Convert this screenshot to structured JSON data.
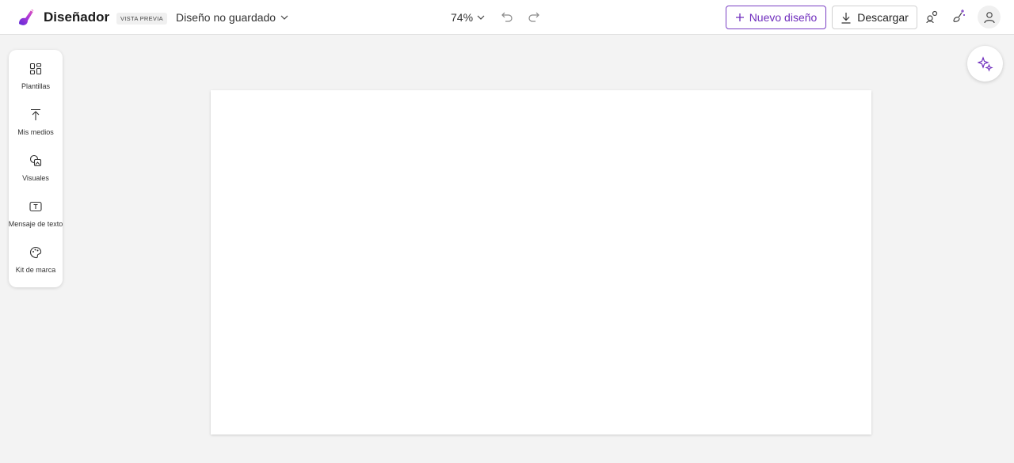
{
  "header": {
    "app_name": "Diseñador",
    "badge": "VISTA PREVIA",
    "doc_title": "Diseño no guardado",
    "zoom": "74%",
    "new_design_label": "Nuevo diseño",
    "download_label": "Descargar",
    "icons": [
      "logo-icon",
      "chevron-down-icon",
      "undo-icon",
      "redo-icon",
      "plus-icon",
      "download-icon",
      "share-icon",
      "sparkle-brush-icon",
      "user-icon"
    ]
  },
  "sidebar": {
    "items": [
      {
        "label": "Plantillas",
        "icon": "templates-icon"
      },
      {
        "label": "Mis medios",
        "icon": "upload-icon"
      },
      {
        "label": "Visuales",
        "icon": "visuals-icon"
      },
      {
        "label": "Mensaje de texto",
        "icon": "text-icon"
      },
      {
        "label": "Kit de marca",
        "icon": "palette-icon"
      }
    ]
  },
  "copilot": {
    "icon": "sparkle-icon"
  },
  "colors": {
    "accent": "#6f2dbd",
    "background": "#f3f3f3",
    "canvas": "#ffffff"
  }
}
